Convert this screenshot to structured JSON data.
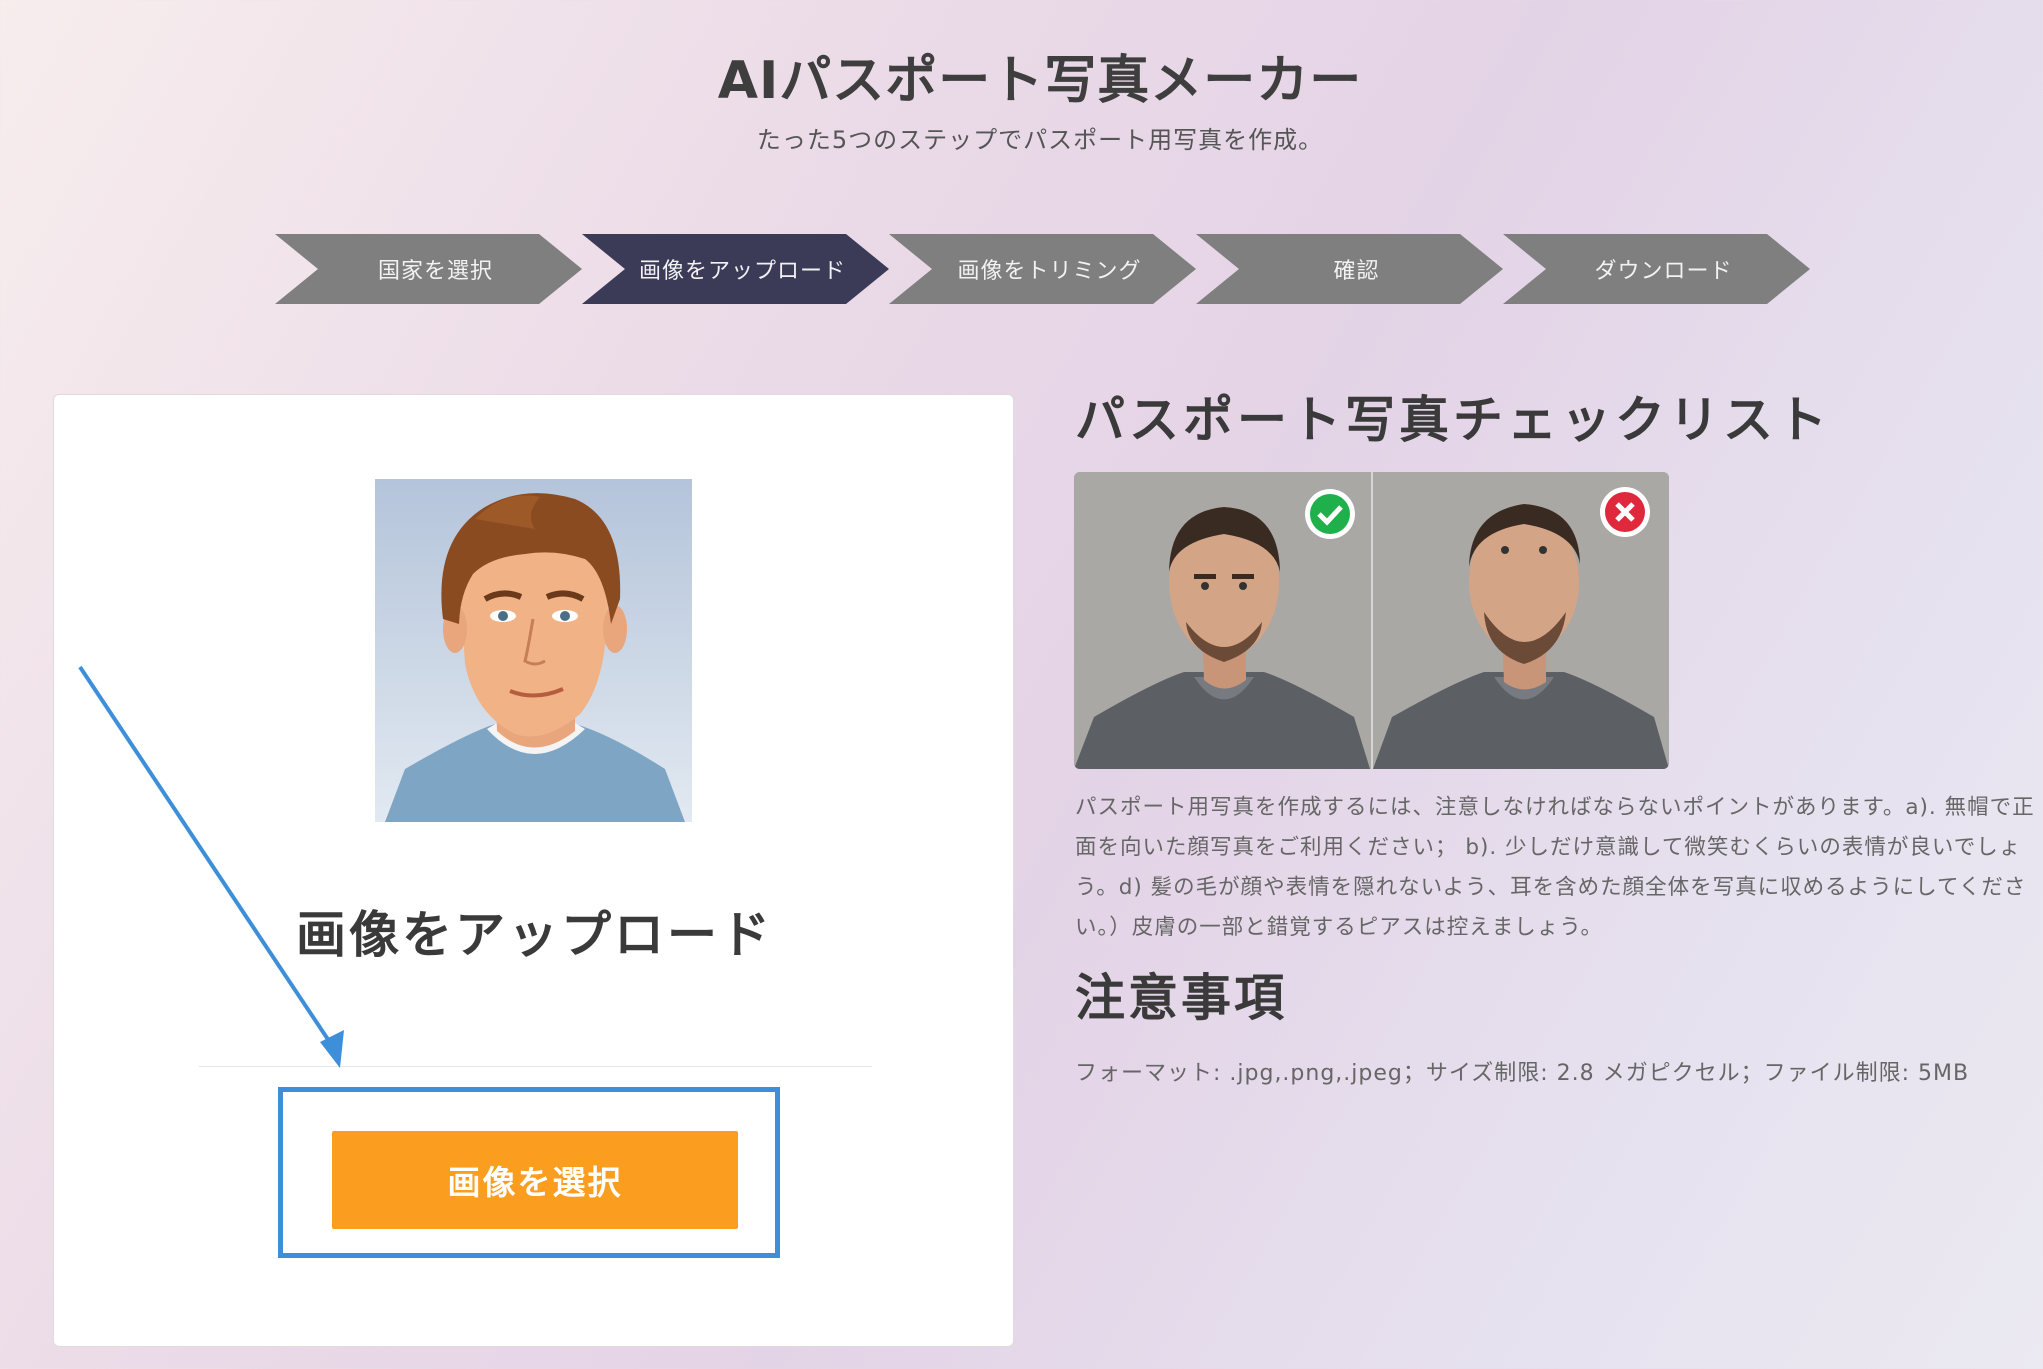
{
  "header": {
    "title": "AIパスポート写真メーカー",
    "subtitle": "たった5つのステップでパスポート用写真を作成。"
  },
  "steps": [
    {
      "label": "国家を選択",
      "active": false
    },
    {
      "label": "画像をアップロード",
      "active": true
    },
    {
      "label": "画像をトリミング",
      "active": false
    },
    {
      "label": "確認",
      "active": false
    },
    {
      "label": "ダウンロード",
      "active": false
    }
  ],
  "upload": {
    "heading": "画像をアップロード",
    "button_label": "画像を選択"
  },
  "checklist": {
    "title": "パスポート写真チェックリスト",
    "description": "パスポート用写真を作成するには、注意しなければならないポイントがあります。a). 無帽で正面を向いた顔写真をご利用ください； b). 少しだけ意識して微笑むくらいの表情が良いでしょう。d) 髪の毛が顔や表情を隠れないよう、耳を含めた顔全体を写真に収めるようにしてください。）皮膚の一部と錯覚するピアスは控えましょう。"
  },
  "notes": {
    "title": "注意事項",
    "format": "フォーマット: .jpg,.png,.jpeg；サイズ制限: 2.8 メガピクセル；ファイル制限: 5MB"
  },
  "colors": {
    "active_step": "#3b3b58",
    "inactive_step": "#7f7f7f",
    "button": "#fb9e1f",
    "highlight": "#3e8fd9",
    "ok_badge": "#20b04b",
    "ng_badge": "#e0283c"
  }
}
